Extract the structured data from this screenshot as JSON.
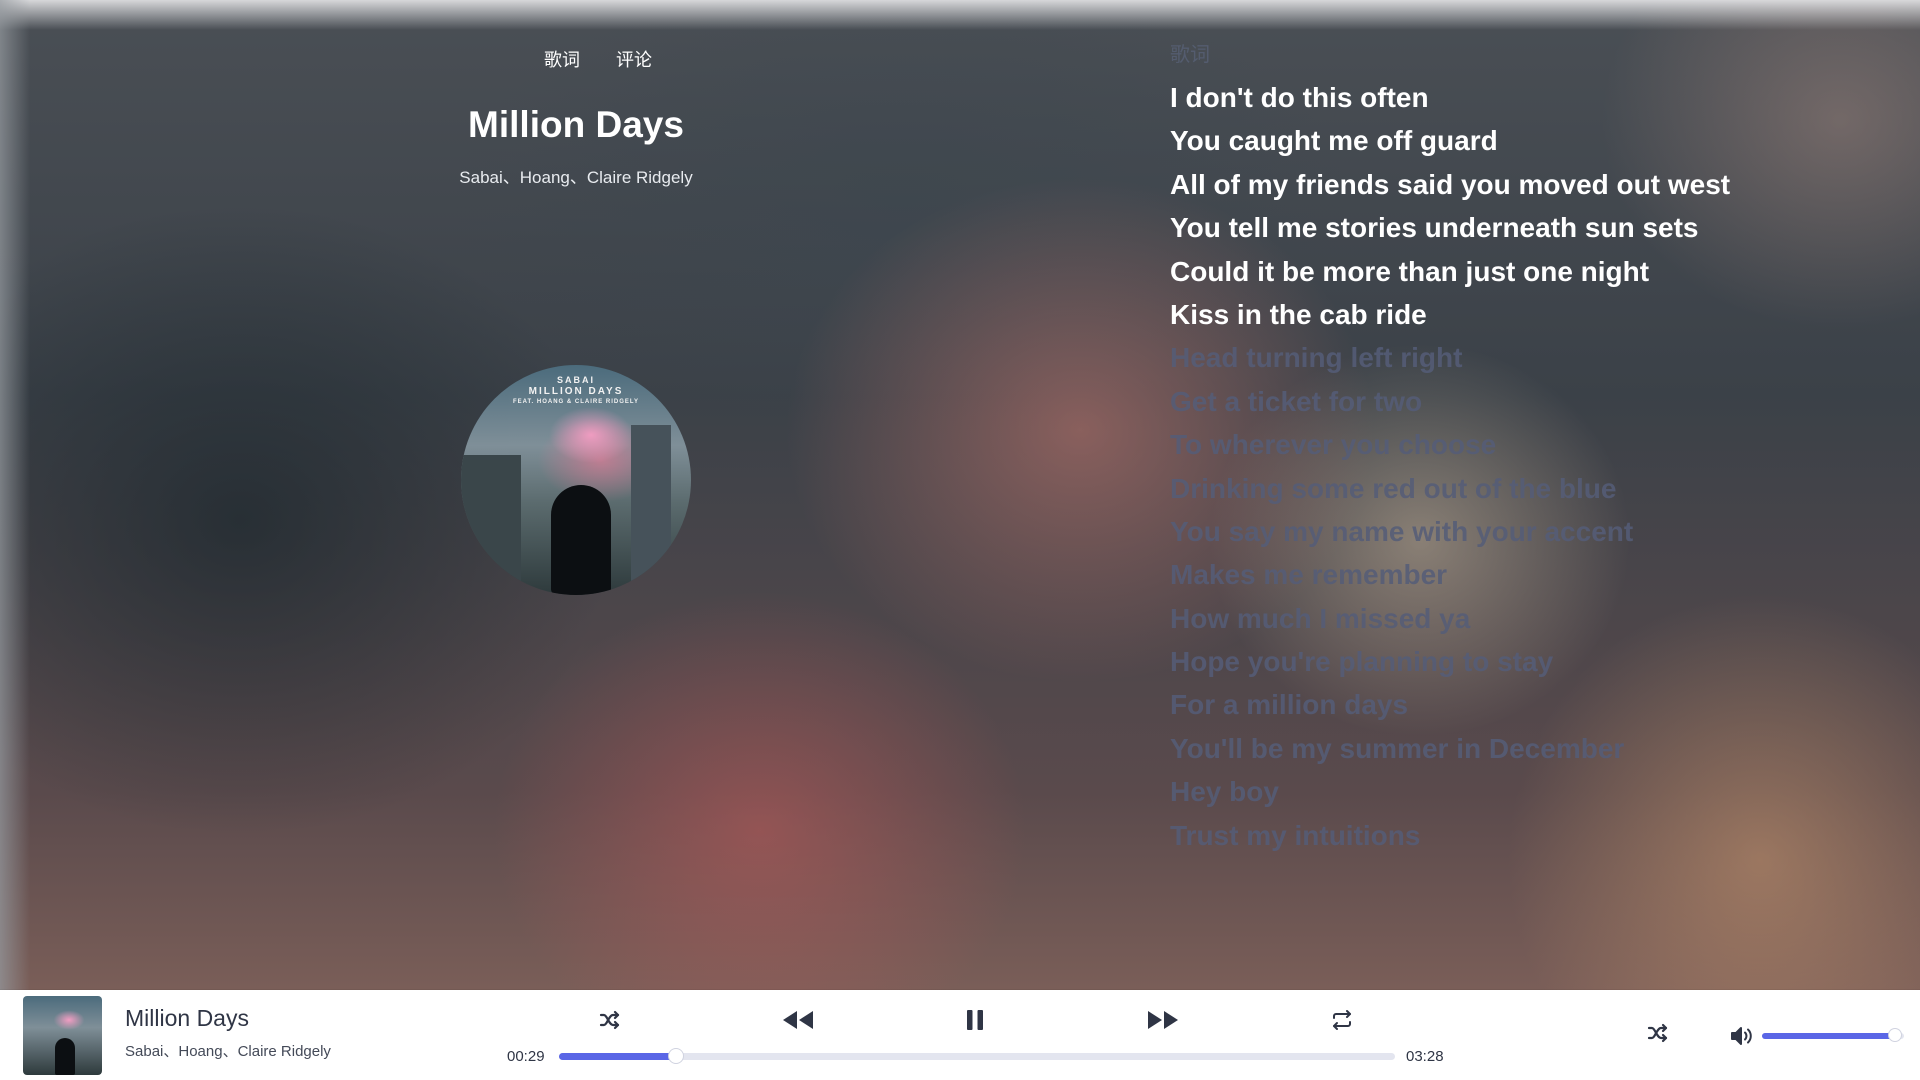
{
  "tabs": {
    "lyrics_label": "歌词",
    "comments_label": "评论"
  },
  "song": {
    "title": "Million Days",
    "artists": "Sabai、Hoang、Claire Ridgely",
    "cover_text": {
      "artist": "SABAI",
      "title": "MILLION DAYS",
      "feat": "FEAT. HOANG & CLAIRE RIDGELY"
    }
  },
  "lyrics": {
    "header": "歌词",
    "lines": [
      {
        "text": "I don't do this often",
        "state": "past"
      },
      {
        "text": "You caught me off guard",
        "state": "past"
      },
      {
        "text": "All of my friends said you moved out west",
        "state": "past"
      },
      {
        "text": "You tell me stories underneath sun sets",
        "state": "past"
      },
      {
        "text": "Could it be more than just one night",
        "state": "past"
      },
      {
        "text": "Kiss in the cab ride",
        "state": "past"
      },
      {
        "text": "Head turning left right",
        "state": "future"
      },
      {
        "text": "Get a ticket for two",
        "state": "future"
      },
      {
        "text": "To wherever you choose",
        "state": "future"
      },
      {
        "text": "Drinking some red out of the blue",
        "state": "future"
      },
      {
        "text": "You say my name with your accent",
        "state": "future"
      },
      {
        "text": "Makes me remember",
        "state": "future"
      },
      {
        "text": "How much I missed ya",
        "state": "future"
      },
      {
        "text": "Hope you're planning to stay",
        "state": "future"
      },
      {
        "text": "For a million days",
        "state": "future"
      },
      {
        "text": "You'll be my summer in December",
        "state": "future"
      },
      {
        "text": "Hey boy",
        "state": "future"
      },
      {
        "text": "Trust my intuitions",
        "state": "future"
      }
    ]
  },
  "player": {
    "title": "Million Days",
    "artists": "Sabai、Hoang、Claire Ridgely",
    "current_time": "00:29",
    "total_time": "03:28",
    "progress_fraction": 0.14,
    "volume_fraction": 0.94,
    "icons": {
      "shuffle": "shuffle-icon",
      "previous": "previous-icon",
      "play_pause": "pause-icon",
      "next": "next-icon",
      "repeat": "repeat-icon",
      "play_mode": "shuffle-icon",
      "volume": "volume-icon"
    },
    "accent_color": "#5a66e6",
    "icon_color": "#2f3545"
  }
}
